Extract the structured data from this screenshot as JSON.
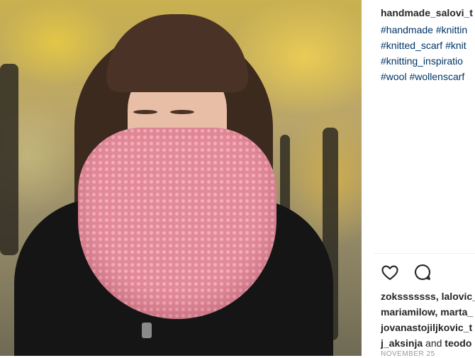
{
  "post": {
    "username": "handmade_salovi_t",
    "hashtag_lines": [
      [
        "#handmade",
        "#knittin"
      ],
      [
        "#knitted_scarf",
        "#knit"
      ],
      [
        "#knitting_inspiratio"
      ],
      [
        "#wool",
        "#wollenscarf"
      ]
    ],
    "likes": {
      "line1": [
        "zoksssssss,",
        "lalovic_"
      ],
      "line2": [
        "mariamilow,",
        "marta_"
      ],
      "line3": [
        "jovanastojiljkovic_t"
      ],
      "line4_user1": "j_aksinja",
      "line4_and": "and",
      "line4_user2": "teodo"
    },
    "time_label": "NOVEMBER 25"
  },
  "icons": {
    "like": "heart-icon",
    "comment": "comment-icon"
  },
  "colors": {
    "hashtag": "#003569",
    "text": "#262626",
    "divider": "#efefef"
  }
}
